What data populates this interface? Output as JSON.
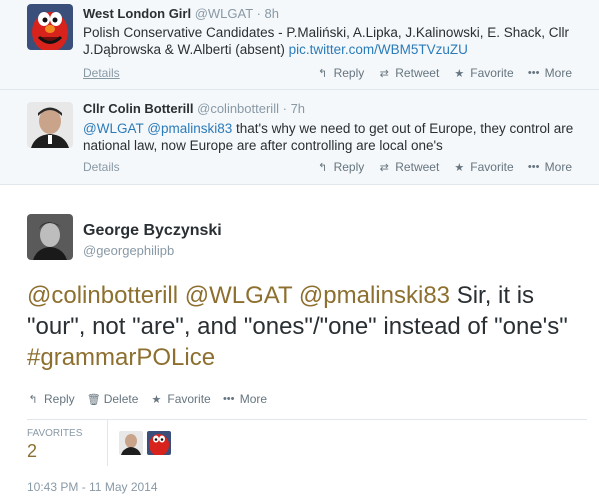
{
  "tweets": [
    {
      "name": "West London Girl",
      "handle": "@WLGAT",
      "sep": "·",
      "time": "8h",
      "text": "Polish Conservative Candidates - P.Maliński, A.Lipka, J.Kalinowski, E. Shack, Cllr J.Dąbrowska & W.Alberti (absent)",
      "link": "pic.twitter.com/WBM5TVzuZU",
      "details": "Details",
      "avatar_icon": "red-monster-avatar"
    },
    {
      "name": "Cllr Colin Botterill",
      "handle": "@colinbotterill",
      "sep": "·",
      "time": "7h",
      "mention1": "@WLGAT",
      "mention2": "@pmalinski83",
      "text": "that's why we need to get out of Europe, they control are national law, now Europe are after controlling are local one's",
      "details": "Details",
      "avatar_icon": "man-portrait-avatar"
    }
  ],
  "actions": {
    "reply": "Reply",
    "retweet": "Retweet",
    "favorite": "Favorite",
    "more": "More",
    "delete": "Delete"
  },
  "main": {
    "name": "George Byczynski",
    "handle": "@georgephilipb",
    "mention1": "@colinbotterill",
    "mention2": "@WLGAT",
    "mention3": "@pmalinski83",
    "text1": "Sir, it is \"our\", not \"are\", and \"ones\"/\"one\" instead of \"one's\"",
    "hashtag": "#grammarPOLice",
    "favorites_label": "FAVORITES",
    "favorites_count": "2",
    "timestamp": "10:43 PM - 11 May 2014"
  },
  "colors": {
    "link": "#2b7bb9",
    "main_accent": "#8d6f2f",
    "muted": "#8899a6"
  }
}
